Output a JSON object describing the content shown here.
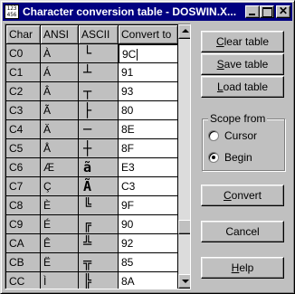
{
  "window": {
    "title": "Character conversion table - DOSWIN.X...",
    "icon_glyph": "123 456"
  },
  "table": {
    "headers": [
      "Char",
      "ANSI",
      "ASCII",
      "Convert to"
    ],
    "rows": [
      {
        "char": "C0",
        "ansi": "À",
        "ascii": "└",
        "convert": "9C"
      },
      {
        "char": "C1",
        "ansi": "Á",
        "ascii": "┴",
        "convert": "91"
      },
      {
        "char": "C2",
        "ansi": "Â",
        "ascii": "┬",
        "convert": "93"
      },
      {
        "char": "C3",
        "ansi": "Ã",
        "ascii": "├",
        "convert": "80"
      },
      {
        "char": "C4",
        "ansi": "Ä",
        "ascii": "─",
        "convert": "8E"
      },
      {
        "char": "C5",
        "ansi": "Å",
        "ascii": "┼",
        "convert": "8F"
      },
      {
        "char": "C6",
        "ansi": "Æ",
        "ascii": "ã",
        "convert": "E3"
      },
      {
        "char": "C7",
        "ansi": "Ç",
        "ascii": "Ã",
        "convert": "C3"
      },
      {
        "char": "C8",
        "ansi": "È",
        "ascii": "╚",
        "convert": "9F"
      },
      {
        "char": "C9",
        "ansi": "É",
        "ascii": "╔",
        "convert": "90"
      },
      {
        "char": "CA",
        "ansi": "Ê",
        "ascii": "╩",
        "convert": "92"
      },
      {
        "char": "CB",
        "ansi": "Ë",
        "ascii": "╦",
        "convert": "85"
      },
      {
        "char": "CC",
        "ansi": "Ì",
        "ascii": "╠",
        "convert": "8A"
      }
    ]
  },
  "buttons": {
    "clear": {
      "pre": "",
      "key": "C",
      "post": "lear table"
    },
    "save": {
      "pre": "",
      "key": "S",
      "post": "ave table"
    },
    "load": {
      "pre": "",
      "key": "L",
      "post": "oad table"
    },
    "convert": {
      "pre": "",
      "key": "C",
      "post": "onvert"
    },
    "cancel": {
      "label": "Cancel"
    },
    "help": {
      "pre": "",
      "key": "H",
      "post": "elp"
    }
  },
  "scope": {
    "label": "Scope from",
    "options": [
      {
        "label": "Cursor",
        "selected": false
      },
      {
        "label": "Begin",
        "selected": true
      }
    ]
  },
  "scrollbar": {
    "position": 0.82
  }
}
